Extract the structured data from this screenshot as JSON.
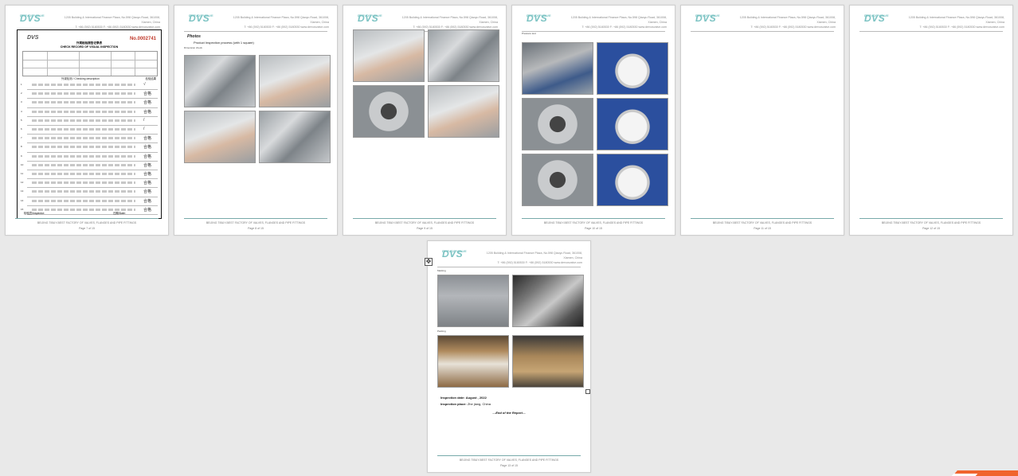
{
  "header": {
    "logo_text": "DVS",
    "logo_sub": "DERVOS VALVE",
    "address_line1": "1205 Building & International Finance Plaza, No.598 Qiaoyu Road, 361008, Xiamen, China",
    "address_line2": "T: +86 (592) 5180530   F: +86 (592) 5180530   www.dervosvalve.com"
  },
  "footer_text": "BEIJING TIBUY-BEST FACTORY OF VALVES, FLANGES AND PIPE FITTINGS",
  "pages": [
    {
      "page_label": "Page 7 of 15"
    },
    {
      "page_label": "Page 8 of 15"
    },
    {
      "page_label": "Page 9 of 15"
    },
    {
      "page_label": "Page 10 of 15"
    },
    {
      "page_label": "Page 11 of 15"
    },
    {
      "page_label": "Page 12 of 15"
    },
    {
      "page_label": "Page 13 of 15"
    }
  ],
  "form": {
    "logo": "DVS",
    "title_cn": "外观检验报告记录表",
    "title_en": "CHECK RECORD OF VISUAL INSPECTION",
    "record_no": "No.0002741",
    "result_label": "检验结果",
    "checking_header": "外观检测 / Checking description",
    "inspector_label": "检验员/Inspector:",
    "date_label": "日期/Date:",
    "marks": [
      "√",
      "合格",
      "合格",
      "合格",
      "/",
      "/",
      "合格",
      "合格",
      "合格",
      "合格",
      "合格",
      "合格",
      "合格",
      "合格",
      "合格"
    ]
  },
  "page8": {
    "title": "Photos",
    "subtitle": "Product Inspection process (with 1 square)",
    "caption": "Dimension check"
  },
  "page10": {
    "caption": "Pressure test"
  },
  "page13": {
    "caption_marking": "Marking",
    "caption_packing": "Packing",
    "inspection_date_label": "Inspection date:",
    "inspection_date_value": "August , 2022",
    "inspection_place_label": "Inspection place:",
    "inspection_place_value": "Zhe jiang, China",
    "end_text": "—End of the Report—"
  },
  "colors": {
    "accent": "#7cc3c3",
    "badge": "#f0642d"
  }
}
